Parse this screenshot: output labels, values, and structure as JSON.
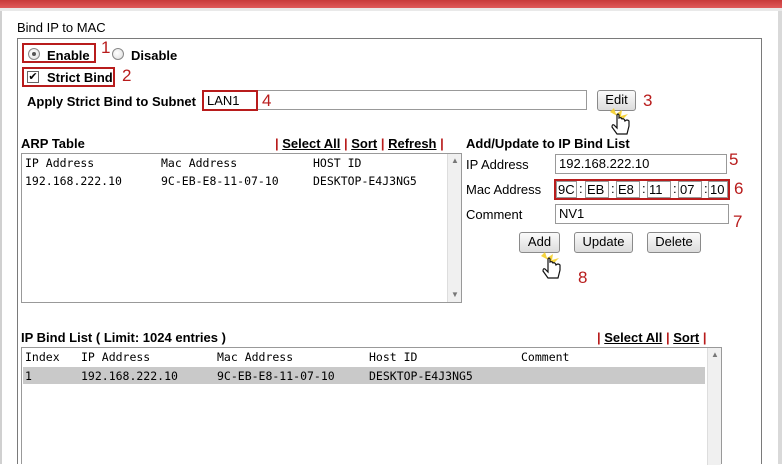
{
  "page": {
    "title": "Bind IP to MAC"
  },
  "mode": {
    "enable_label": "Enable",
    "disable_label": "Disable",
    "selected": "Enable"
  },
  "strict_bind": {
    "label": "Strict Bind",
    "checked": true,
    "subnet_label": "Apply Strict Bind to Subnet",
    "subnet_value": "LAN1",
    "edit_label": "Edit"
  },
  "arp_table": {
    "title": "ARP Table",
    "actions": [
      "Select All",
      "Sort",
      "Refresh"
    ],
    "columns": [
      "IP Address",
      "Mac Address",
      "HOST ID"
    ],
    "rows": [
      [
        "192.168.222.10",
        "9C-EB-E8-11-07-10",
        "DESKTOP-E4J3NG5"
      ]
    ]
  },
  "add_update": {
    "title": "Add/Update to IP Bind List",
    "ip_label": "IP Address",
    "ip_value": "192.168.222.10",
    "mac_label": "Mac Address",
    "mac_octets": [
      "9C",
      "EB",
      "E8",
      "11",
      "07",
      "10"
    ],
    "comment_label": "Comment",
    "comment_value": "NV1",
    "add_label": "Add",
    "update_label": "Update",
    "delete_label": "Delete"
  },
  "ip_bind_list": {
    "title": "IP Bind List ( Limit: 1024 entries )",
    "actions": [
      "Select All",
      "Sort"
    ],
    "columns": [
      "Index",
      "IP Address",
      "Mac Address",
      "Host ID",
      "Comment"
    ],
    "rows": [
      [
        "1",
        "192.168.222.10",
        "9C-EB-E8-11-07-10",
        "DESKTOP-E4J3NG5",
        ""
      ]
    ]
  },
  "annotations": [
    "1",
    "2",
    "3",
    "4",
    "5",
    "6",
    "7",
    "8"
  ],
  "colors": {
    "annotation_red": "#b81c1c",
    "top_bar": "#d04040",
    "selected_row": "#c9c9c9"
  }
}
